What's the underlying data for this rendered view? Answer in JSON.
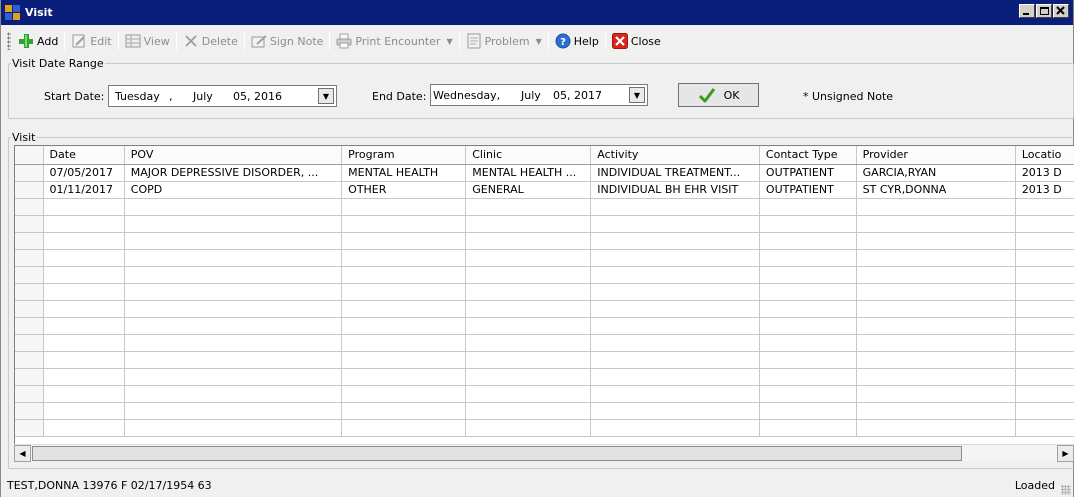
{
  "window": {
    "title": "Visit"
  },
  "toolbar": {
    "items": [
      {
        "label": "Add",
        "icon": "add-icon",
        "enabled": true
      },
      {
        "label": "Edit",
        "icon": "edit-icon",
        "enabled": false
      },
      {
        "label": "View",
        "icon": "view-icon",
        "enabled": false
      },
      {
        "label": "Delete",
        "icon": "delete-icon",
        "enabled": false
      },
      {
        "label": "Sign Note",
        "icon": "sign-note-icon",
        "enabled": false
      },
      {
        "label": "Print Encounter",
        "icon": "print-icon",
        "enabled": false,
        "dropdown": true
      },
      {
        "label": "Problem",
        "icon": "problem-icon",
        "enabled": false,
        "dropdown": true
      },
      {
        "label": "Help",
        "icon": "help-icon",
        "enabled": true
      },
      {
        "label": "Close",
        "icon": "close-icon",
        "enabled": true
      }
    ]
  },
  "date_range": {
    "legend": "Visit Date Range",
    "start_label": "Start Date:",
    "start_day": "Tuesday",
    "start_sep": ",",
    "start_month": "July",
    "start_daynum_year": "05, 2016",
    "end_label": "End Date:",
    "end_day": "Wednesday,",
    "end_month": "July",
    "end_daynum_year": "05, 2017",
    "ok_label": "OK",
    "unsigned_note": "* Unsigned Note"
  },
  "visit_grid": {
    "legend": "Visit",
    "columns": [
      "Date",
      "POV",
      "Program",
      "Clinic",
      "Activity",
      "Contact Type",
      "Provider",
      "Locatio"
    ],
    "rows": [
      [
        "07/05/2017",
        "MAJOR DEPRESSIVE DISORDER, ...",
        "MENTAL HEALTH",
        "MENTAL HEALTH ...",
        "INDIVIDUAL TREATMENT...",
        "OUTPATIENT",
        "GARCIA,RYAN",
        "2013 D"
      ],
      [
        "01/11/2017",
        "COPD",
        "OTHER",
        "GENERAL",
        "INDIVIDUAL BH EHR VISIT",
        "OUTPATIENT",
        "ST CYR,DONNA",
        "2013 D"
      ]
    ]
  },
  "status": {
    "patient": "TEST,DONNA 13976  F 02/17/1954 63",
    "state": "Loaded"
  },
  "colors": {
    "title_bar": "#0a1f7a",
    "add_green": "#2fa52f",
    "close_red": "#d9261c",
    "ok_check_green": "#3a9a1e"
  }
}
